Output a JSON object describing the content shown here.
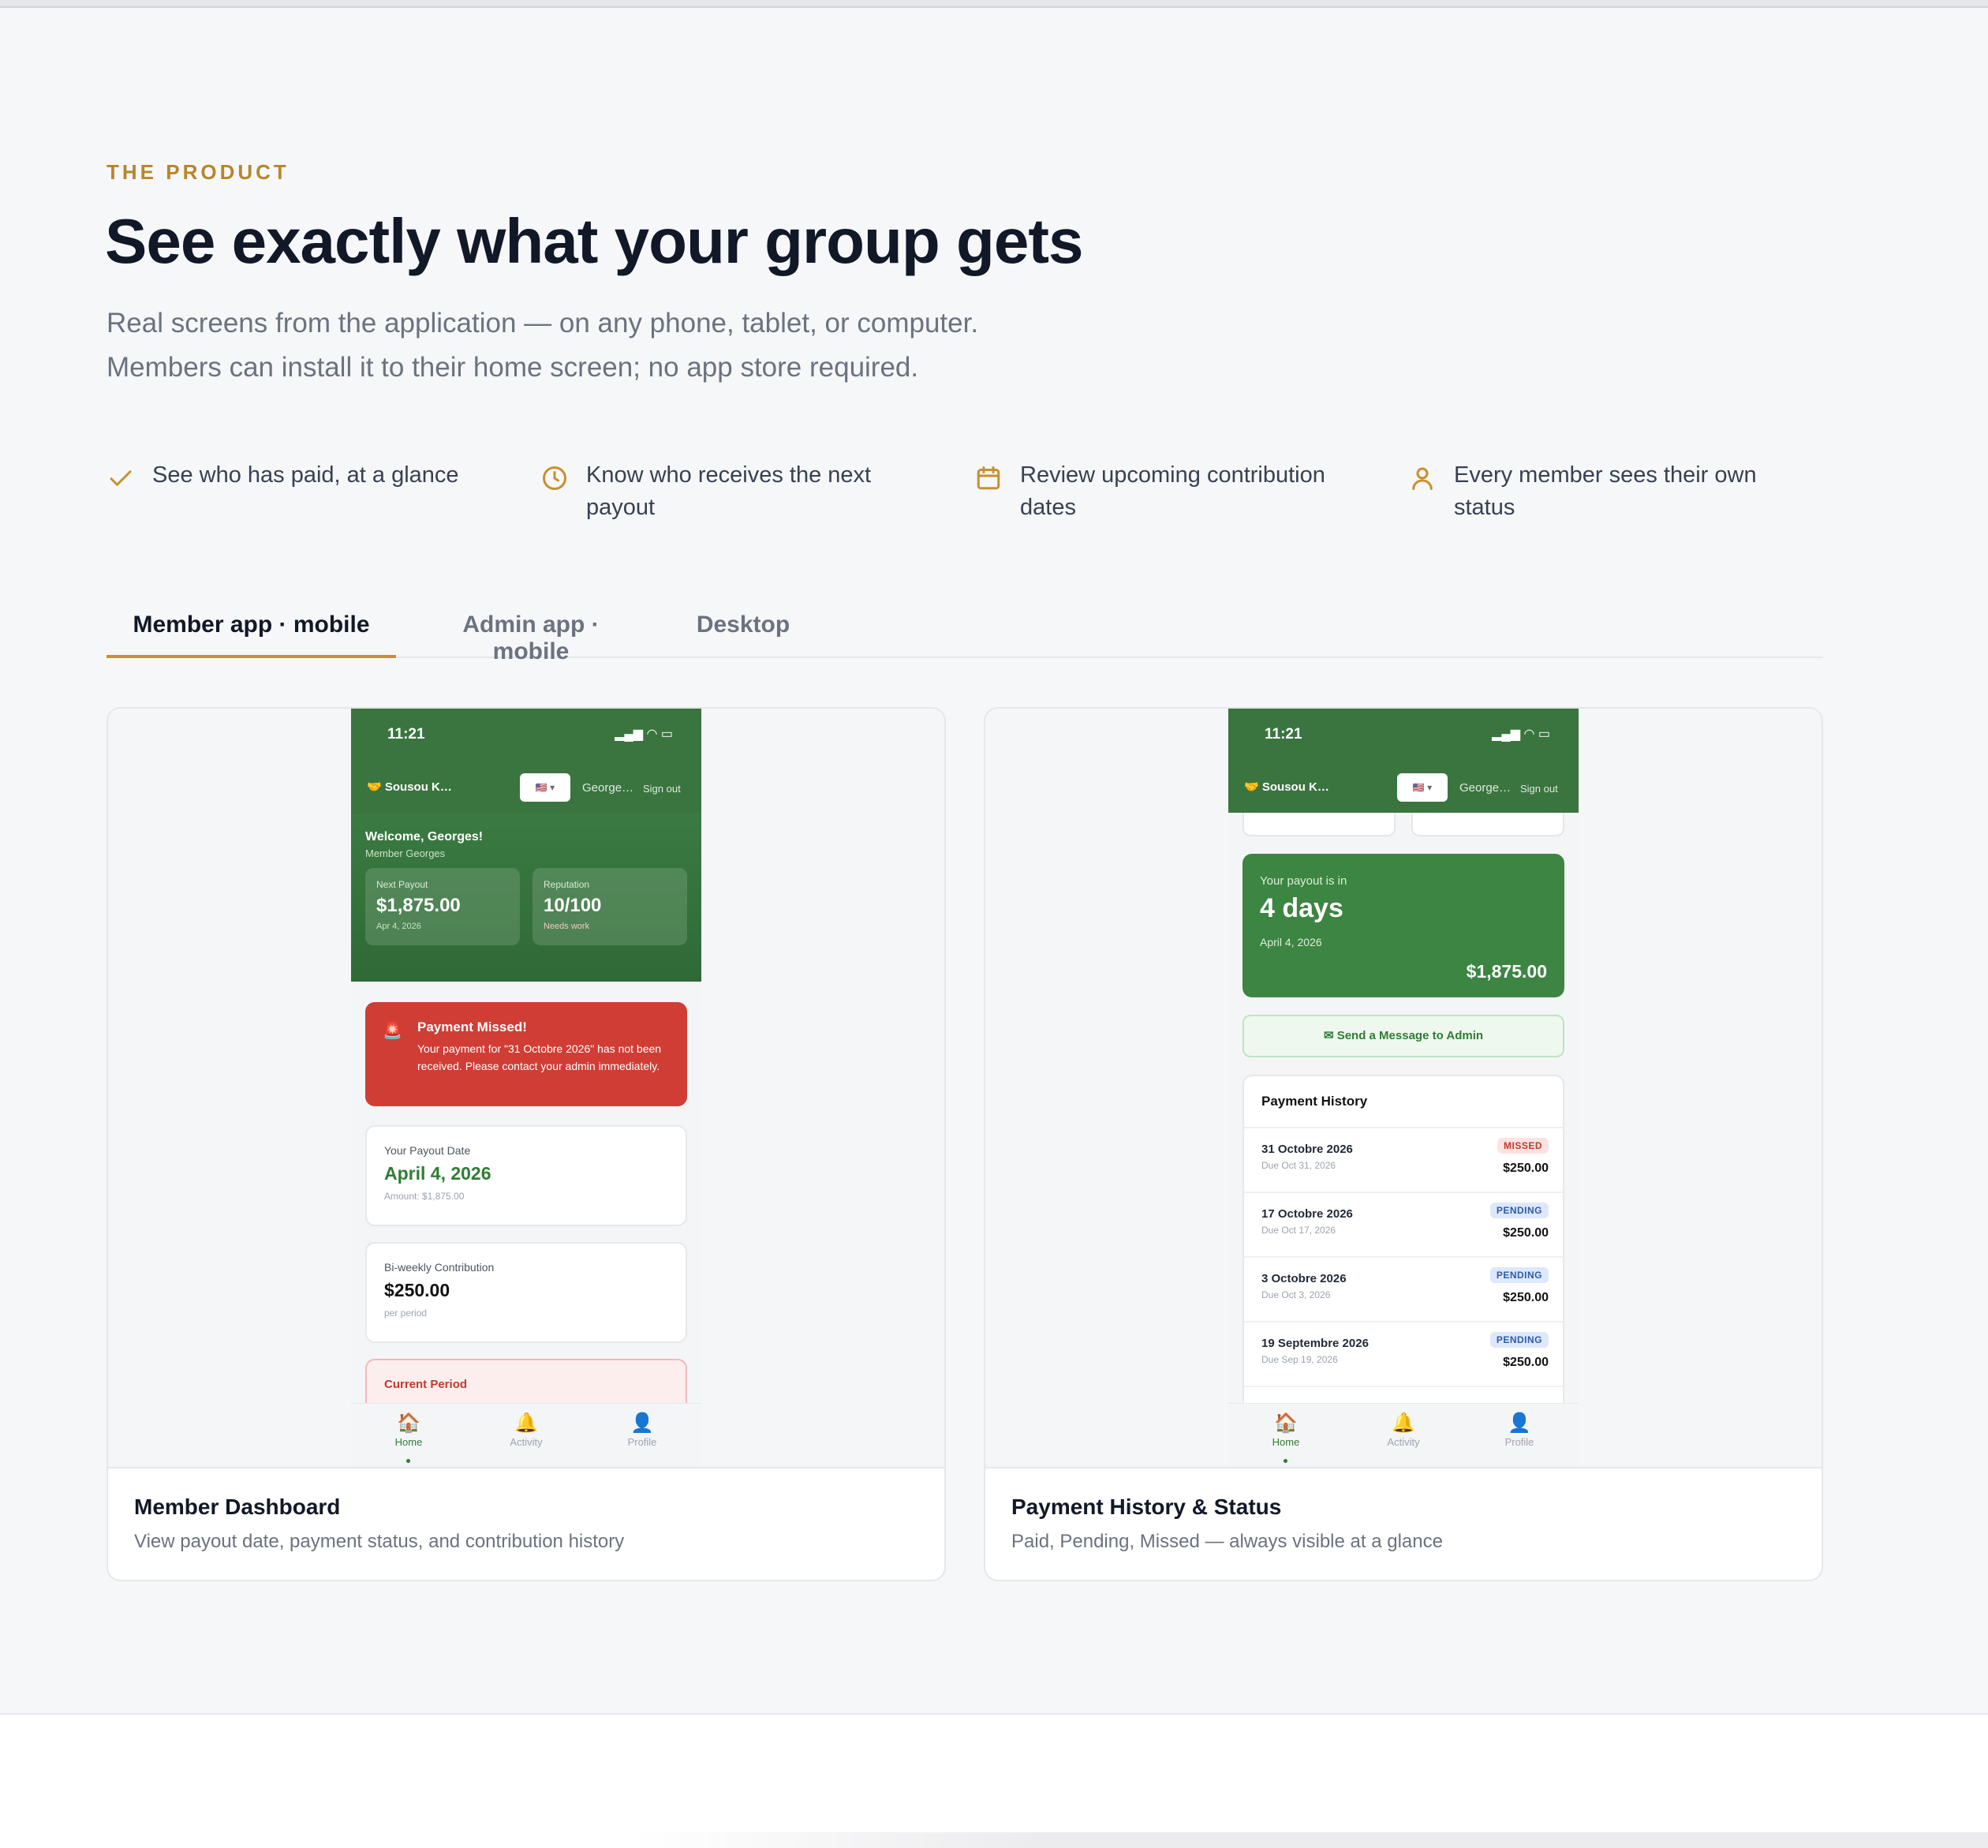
{
  "section": {
    "eyebrow": "THE PRODUCT",
    "headline": "See exactly what your group gets",
    "subtitle_line1": "Real screens from the application — on any phone, tablet, or computer.",
    "subtitle_line2": "Members can install it to their home screen; no app store required."
  },
  "features": [
    {
      "icon": "check-icon",
      "text": "See who has paid, at a glance"
    },
    {
      "icon": "clock-icon",
      "text": "Know who receives the next payout"
    },
    {
      "icon": "calendar-icon",
      "text": "Review upcoming contribution dates"
    },
    {
      "icon": "user-icon",
      "text": "Every member sees their own status"
    }
  ],
  "tabs": [
    {
      "label": "Member app · mobile",
      "active": true
    },
    {
      "label": "Admin app · mobile",
      "active": false
    },
    {
      "label": "Desktop",
      "active": false
    }
  ],
  "colors": {
    "accent": "#c8902f",
    "eyebrow": "#b7862b",
    "app_green": "#3a7540",
    "alert_red": "#d03d35"
  },
  "cards": [
    {
      "title": "Member Dashboard",
      "description": "View payout date, payment status, and contribution history",
      "phone": {
        "time": "11:21",
        "brand": "Sousou K…",
        "user": "George…",
        "sign_out": "Sign out",
        "welcome": "Welcome, Georges!",
        "welcome_sub": "Member Georges",
        "next_payout_label": "Next Payout",
        "next_payout_value": "$1,875.00",
        "next_payout_date": "Apr 4, 2026",
        "reputation_label": "Reputation",
        "reputation_value": "10/100",
        "reputation_note": "Needs work",
        "alert_title": "Payment Missed!",
        "alert_text": "Your payment for \"31 Octobre 2026\" has not been received. Please contact your admin immediately.",
        "payout_date_label": "Your Payout Date",
        "payout_date_value": "April 4, 2026",
        "payout_amount": "Amount: $1,875.00",
        "contribution_label": "Bi-weekly Contribution",
        "contribution_value": "$250.00",
        "contribution_note": "per period",
        "current_period": "Current Period",
        "nav": [
          "Home",
          "Activity",
          "Profile"
        ]
      }
    },
    {
      "title": "Payment History & Status",
      "description": "Paid, Pending, Missed — always visible at a glance",
      "phone": {
        "time": "11:21",
        "brand": "Sousou K…",
        "user": "George…",
        "sign_out": "Sign out",
        "payout_in_label": "Your payout is in",
        "payout_in_value": "4 days",
        "payout_date": "April 4, 2026",
        "payout_amount": "$1,875.00",
        "message_button": "✉ Send a Message to Admin",
        "history_title": "Payment History",
        "history": [
          {
            "name": "31 Octobre 2026",
            "due": "Due Oct 31, 2026",
            "status": "MISSED",
            "amount": "$250.00"
          },
          {
            "name": "17 Octobre 2026",
            "due": "Due Oct 17, 2026",
            "status": "PENDING",
            "amount": "$250.00"
          },
          {
            "name": "3 Octobre 2026",
            "due": "Due Oct 3, 2026",
            "status": "PENDING",
            "amount": "$250.00"
          },
          {
            "name": "19 Septembre 2026",
            "due": "Due Sep 19, 2026",
            "status": "PENDING",
            "amount": "$250.00"
          }
        ],
        "nav": [
          "Home",
          "Activity",
          "Profile"
        ]
      }
    }
  ]
}
